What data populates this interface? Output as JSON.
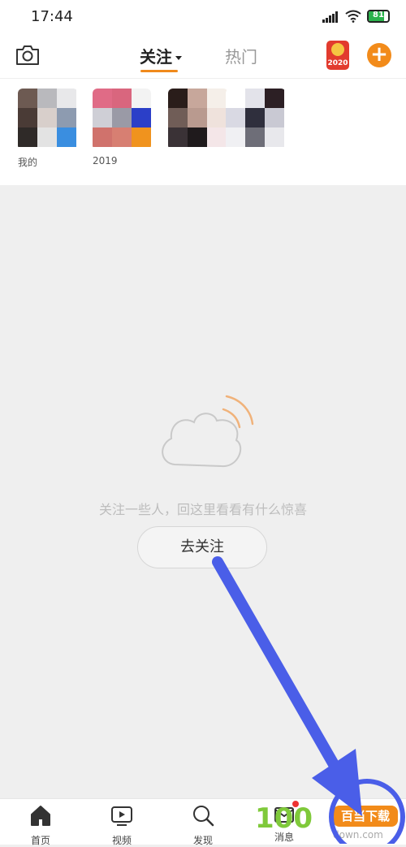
{
  "status": {
    "time": "17:44",
    "battery": "81",
    "battery_fraction": 0.81
  },
  "header": {
    "tab_follow": "关注",
    "tab_hot": "热门",
    "badge_year": "2020",
    "add_label": "+"
  },
  "follow_strip": {
    "items": [
      {
        "label": "我的"
      },
      {
        "label": "2019"
      },
      {
        "label": ""
      },
      {
        "label": ""
      }
    ]
  },
  "empty_state": {
    "message": "关注一些人，回这里看看有什么惊喜",
    "button_label": "去关注"
  },
  "bottom_nav": {
    "items": [
      {
        "label": "首页",
        "icon": "home-icon"
      },
      {
        "label": "视频",
        "icon": "video-icon"
      },
      {
        "label": "发现",
        "icon": "search-icon"
      },
      {
        "label": "消息",
        "icon": "message-icon"
      }
    ]
  },
  "watermark": {
    "logo": "100",
    "badge": "百当下载",
    "url": "down.com"
  },
  "colors": {
    "accent": "#f28b1a",
    "annotation": "#4a5ee8",
    "background": "#efefef"
  }
}
